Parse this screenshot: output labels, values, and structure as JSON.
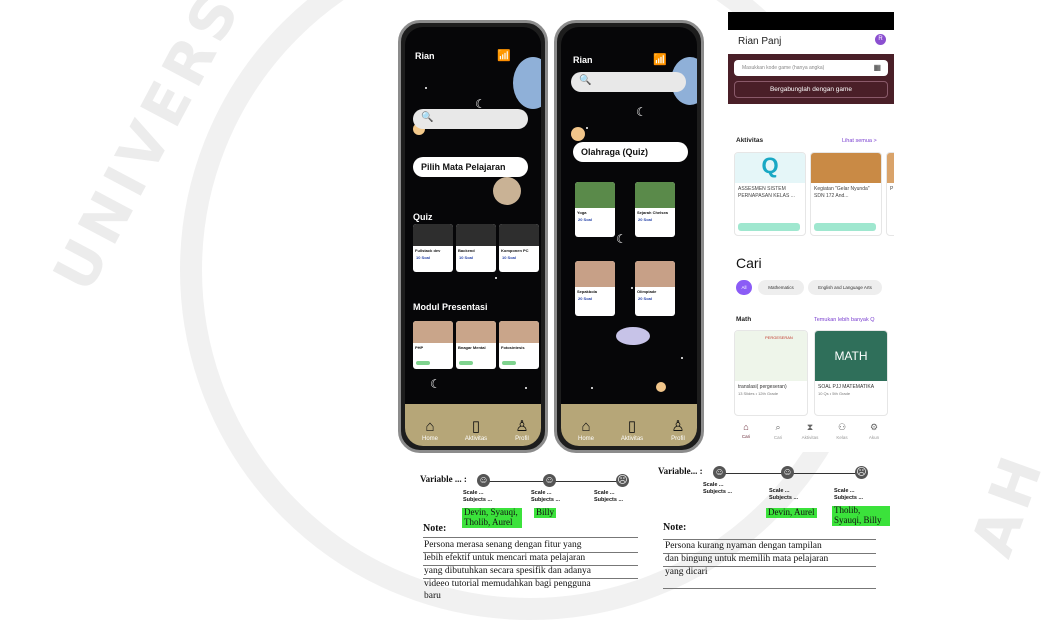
{
  "phone1": {
    "user": "Rian",
    "search_icon": "search-icon",
    "pick_subject": "Pilih Mata Pelajaran",
    "quiz_title": "Quiz",
    "quiz_cards": [
      {
        "title": "Fullstack dev",
        "badge": "10 Soal"
      },
      {
        "title": "Backend",
        "badge": "10 Soal"
      },
      {
        "title": "Komponen PC",
        "badge": "10 Soal"
      }
    ],
    "modul_title": "Modul Presentasi",
    "modul_cards": [
      {
        "title": "PHP"
      },
      {
        "title": "Bnagar Mental"
      },
      {
        "title": "Fotosintesis"
      }
    ],
    "nav": [
      "Home",
      "Aktivitas",
      "Profil"
    ]
  },
  "phone2": {
    "user": "Rian",
    "category": "Olahraga (Quiz)",
    "cards": [
      {
        "title": "Yoga",
        "badge": "20 Soal"
      },
      {
        "title": "Sejarah Chelsea",
        "badge": "20 Soal"
      },
      {
        "title": "Sepakbola",
        "badge": "20 Soal"
      },
      {
        "title": "Olimpiade",
        "badge": "20 Soal"
      }
    ],
    "nav": [
      "Home",
      "Aktivitas",
      "Profil"
    ]
  },
  "app3": {
    "user": "Rian Panj",
    "avatar": "R",
    "code_placeholder": "Masukkan kode game (hanya angka)",
    "join_button": "Bergabunglah dengan game",
    "aktivitas_title": "Aktivitas",
    "see_all": "Lihat semua >",
    "activities": [
      {
        "title": "ASSESMEN SISTEM PERNAPASAN KELAS ..."
      },
      {
        "title": "Kegiatan \"Gelar Nyunda\" SDN 172 And..."
      },
      {
        "title": "P B"
      }
    ],
    "cari_title": "Cari",
    "chips": [
      "All",
      "Mathematics",
      "English and Language Arts"
    ],
    "math_title": "Math",
    "more_link": "Temukan lebih banyak Q",
    "math_cards": [
      {
        "title": "translasi( pergeseran)",
        "sub": "13 Slides • 12th Grade",
        "img_text": "PERGESERAN"
      },
      {
        "title": "SOAL PJJ MATEMATIKA",
        "sub": "10 Qs • 5th Grade",
        "img_text": "MATH"
      }
    ],
    "nav": [
      "Cari",
      "Cari",
      "Aktivitas",
      "Kelas",
      "Akun"
    ]
  },
  "persona_left": {
    "variable": "Variable ... :",
    "scales": [
      {
        "l1": "Scale ...",
        "l2": "Subjects ..."
      },
      {
        "l1": "Scale ...",
        "l2": "Subjects ..."
      },
      {
        "l1": "Scale ...",
        "l2": "Subjects ..."
      }
    ],
    "names_1": "Devin, Syauqi, Tholib, Aurel",
    "names_2": "Billy",
    "note_label": "Note:",
    "note_lines": [
      "Persona merasa senang dengan fitur yang",
      "lebih efektif untuk mencari mata pelajaran",
      "yang dibutuhkan  secara spesifik dan adanya",
      "videeo tutorial memudahkan bagi pengguna",
      "baru"
    ]
  },
  "persona_right": {
    "variable": "Variable... :",
    "scales": [
      {
        "l1": "Scale ...",
        "l2": "Subjects ..."
      },
      {
        "l1": "Scale ...",
        "l2": "Subjects ..."
      },
      {
        "l1": "Scale ...",
        "l2": "Subjects ..."
      }
    ],
    "names_2": "Devin, Aurel",
    "names_3": "Tholib, Syauqi, Billy",
    "note_label": "Note:",
    "note_lines": [
      "Persona kurang nyaman dengan tampilan",
      "dan bingung untuk memilih mata pelajaran",
      "yang dicari"
    ]
  },
  "watermark": {
    "left_text": "UNIVERSITAS",
    "right_text": "AH"
  },
  "colors": {
    "space_bg": "#060608",
    "nav_bar": "#b6a678",
    "join_bg": "#4a1f28",
    "highlight": "#3be23b",
    "accent_purple": "#8b5cf6"
  }
}
